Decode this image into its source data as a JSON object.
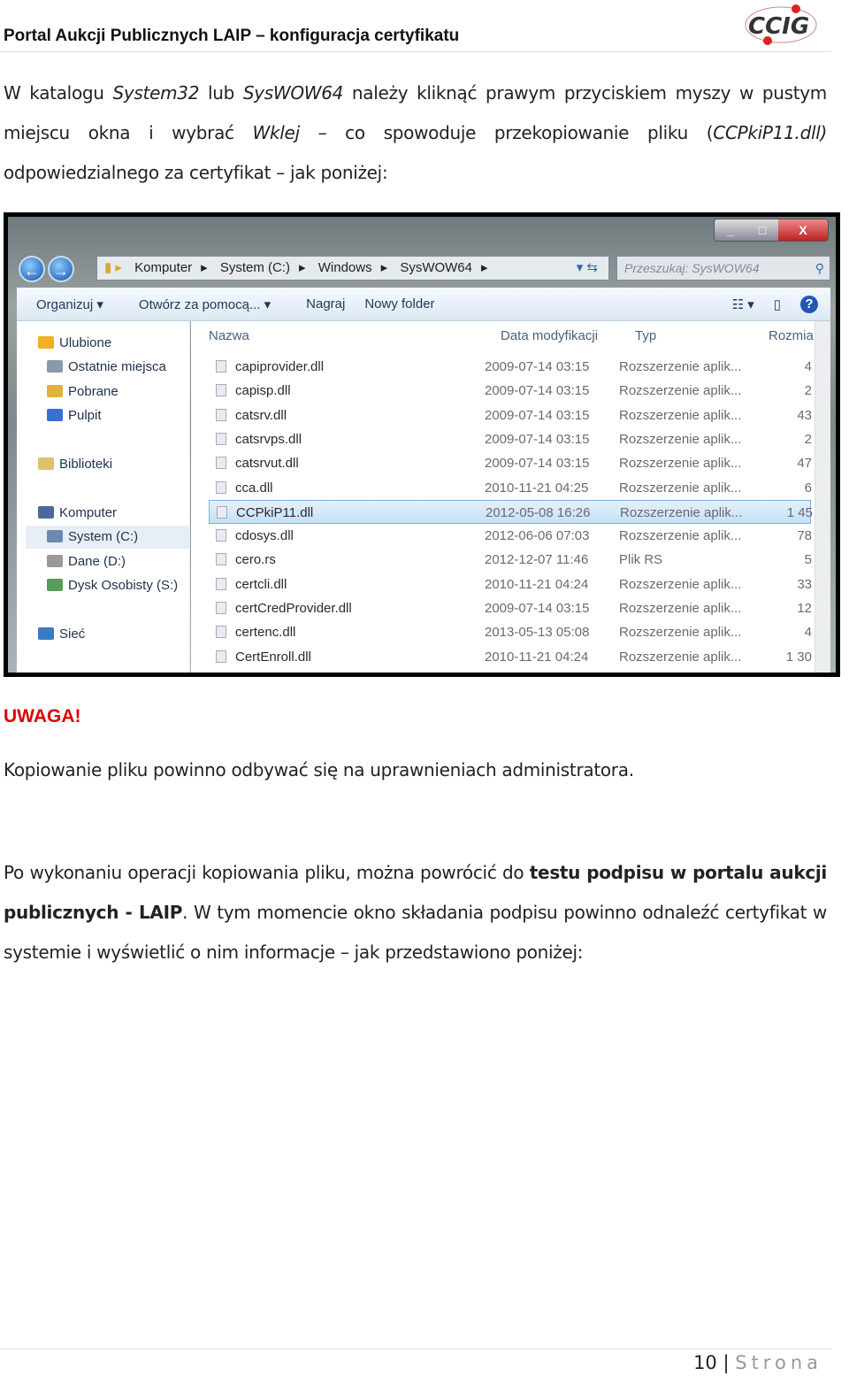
{
  "header": {
    "title": "Portal Aukcji Publicznych LAIP – konfiguracja certyfikatu",
    "logo_text": "CCIG"
  },
  "para1": {
    "a": "W katalogu ",
    "b": "System32",
    "c": " lub ",
    "d": "SysWOW64",
    "e": " należy kliknąć prawym przyciskiem myszy w pustym miejscu okna i wybrać ",
    "f": "Wklej",
    "g": " – co spowoduje przekopiowanie pliku (",
    "h": "CCPkiP11.dll)",
    "i": " odpowiedzialnego za certyfikat – jak poniżej:"
  },
  "explorer": {
    "window_controls": [
      "_",
      "□",
      "X"
    ],
    "breadcrumb": [
      "Komputer",
      "System (C:)",
      "Windows",
      "SysWOW64"
    ],
    "search_placeholder": "Przeszukaj: SysWOW64",
    "toolbar": [
      "Organizuj ▾",
      "Otwórz za pomocą... ▾",
      "Nagraj",
      "Nowy folder"
    ],
    "sidebar": [
      {
        "label": "Ulubione",
        "color": "#f0b020"
      },
      {
        "label": "Ostatnie miejsca",
        "color": "#8899aa"
      },
      {
        "label": "Pobrane",
        "color": "#e0b040"
      },
      {
        "label": "Pulpit",
        "color": "#3a6fd0"
      },
      {
        "label": "Biblioteki",
        "color": "#e0c070"
      },
      {
        "label": "Komputer",
        "color": "#4a6a9a"
      },
      {
        "label": "System (C:)",
        "color": "#6a8ab0"
      },
      {
        "label": "Dane (D:)",
        "color": "#999"
      },
      {
        "label": "Dysk Osobisty (S:)",
        "color": "#5a9a5a"
      },
      {
        "label": "Sieć",
        "color": "#3a7ac0"
      }
    ],
    "columns": [
      "Nazwa",
      "Data modyfikacji",
      "Typ",
      "Rozmia"
    ],
    "files": [
      [
        "capiprovider.dll",
        "2009-07-14 03:15",
        "Rozszerzenie aplik...",
        "4"
      ],
      [
        "capisp.dll",
        "2009-07-14 03:15",
        "Rozszerzenie aplik...",
        "2"
      ],
      [
        "catsrv.dll",
        "2009-07-14 03:15",
        "Rozszerzenie aplik...",
        "43"
      ],
      [
        "catsrvps.dll",
        "2009-07-14 03:15",
        "Rozszerzenie aplik...",
        "2"
      ],
      [
        "catsrvut.dll",
        "2009-07-14 03:15",
        "Rozszerzenie aplik...",
        "47"
      ],
      [
        "cca.dll",
        "2010-11-21 04:25",
        "Rozszerzenie aplik...",
        "6"
      ],
      [
        "CCPkiP11.dll",
        "2012-05-08 16:26",
        "Rozszerzenie aplik...",
        "1 45"
      ],
      [
        "cdosys.dll",
        "2012-06-06 07:03",
        "Rozszerzenie aplik...",
        "78"
      ],
      [
        "cero.rs",
        "2012-12-07 11:46",
        "Plik RS",
        "5"
      ],
      [
        "certcli.dll",
        "2010-11-21 04:24",
        "Rozszerzenie aplik...",
        "33"
      ],
      [
        "certCredProvider.dll",
        "2009-07-14 03:15",
        "Rozszerzenie aplik...",
        "12"
      ],
      [
        "certenc.dll",
        "2013-05-13 05:08",
        "Rozszerzenie aplik...",
        "4"
      ],
      [
        "CertEnroll.dll",
        "2010-11-21 04:24",
        "Rozszerzenie aplik...",
        "1 30"
      ]
    ],
    "selected_file": "CCPkiP11.dll"
  },
  "warning": "UWAGA!",
  "para2": "Kopiowanie pliku powinno odbywać się na uprawnieniach administratora.",
  "para3": {
    "a": "Po wykonaniu operacji kopiowania pliku, można powrócić do ",
    "b": "testu podpisu w portalu aukcji publicznych - LAIP",
    "c": ". W tym momencie okno składania podpisu powinno odnaleźć certyfikat w systemie i wyświetlić o nim informacje – jak przedstawiono poniżej:"
  },
  "footer": {
    "page": "10",
    "sep": " | ",
    "label": "Strona"
  }
}
